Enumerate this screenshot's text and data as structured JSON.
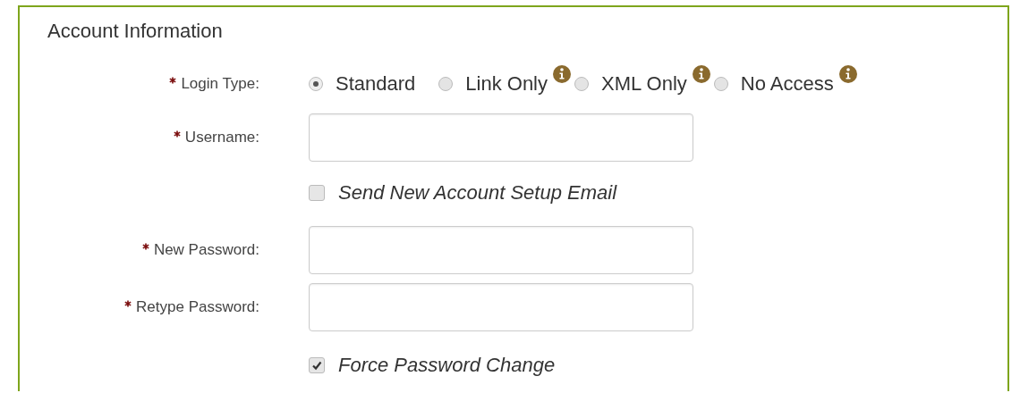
{
  "title": "Account Information",
  "fields": [
    {
      "kind": "radio",
      "label": "Login Type:",
      "required": true,
      "options": [
        {
          "label": "Standard",
          "selected": true,
          "info": false
        },
        {
          "label": "Link Only",
          "selected": false,
          "info": true
        },
        {
          "label": "XML Only",
          "selected": false,
          "info": true
        },
        {
          "label": "No Access",
          "selected": false,
          "info": true
        }
      ]
    },
    {
      "kind": "text",
      "label": "Username:",
      "required": true
    },
    {
      "kind": "checkbox",
      "label": "Send New Account Setup Email",
      "checked": false
    },
    {
      "kind": "text",
      "label": "New Password:",
      "required": true
    },
    {
      "kind": "text",
      "label": "Retype Password:",
      "required": true
    },
    {
      "kind": "checkbox",
      "label": "Force Password Change",
      "checked": true
    }
  ]
}
